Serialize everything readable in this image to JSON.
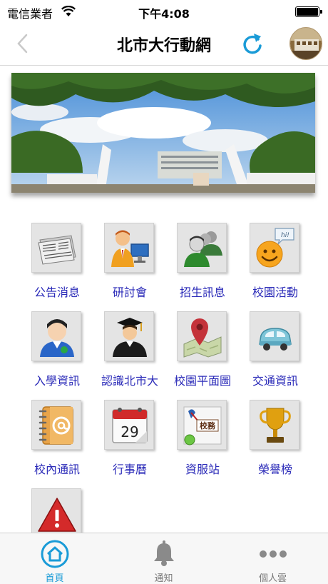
{
  "status_bar": {
    "carrier": "電信業者",
    "time": "下午4:08"
  },
  "nav": {
    "title": "北市大行動網"
  },
  "menu": [
    {
      "label": "公告消息",
      "icon": "newspaper-icon"
    },
    {
      "label": "研討會",
      "icon": "presenter-icon"
    },
    {
      "label": "招生訊息",
      "icon": "people-group-icon"
    },
    {
      "label": "校園活動",
      "icon": "smiley-chat-icon"
    },
    {
      "label": "入學資訊",
      "icon": "student-icon"
    },
    {
      "label": "認識北市大",
      "icon": "graduate-icon"
    },
    {
      "label": "校園平面圖",
      "icon": "map-pin-icon"
    },
    {
      "label": "交通資訊",
      "icon": "car-icon"
    },
    {
      "label": "校內通訊",
      "icon": "address-book-icon"
    },
    {
      "label": "行事曆",
      "icon": "calendar-icon"
    },
    {
      "label": "資服站",
      "icon": "service-station-icon"
    },
    {
      "label": "榮譽榜",
      "icon": "trophy-icon"
    },
    {
      "label": "",
      "icon": "warning-icon"
    }
  ],
  "calendar_day": "29",
  "service_badge": "校務",
  "tabs": [
    {
      "label": "首頁",
      "active": true
    },
    {
      "label": "通知",
      "active": false
    },
    {
      "label": "個人雲",
      "active": false
    }
  ],
  "colors": {
    "accent": "#1a9bd7",
    "label_blue": "#2a2ab8",
    "tab_inactive": "#777777"
  }
}
